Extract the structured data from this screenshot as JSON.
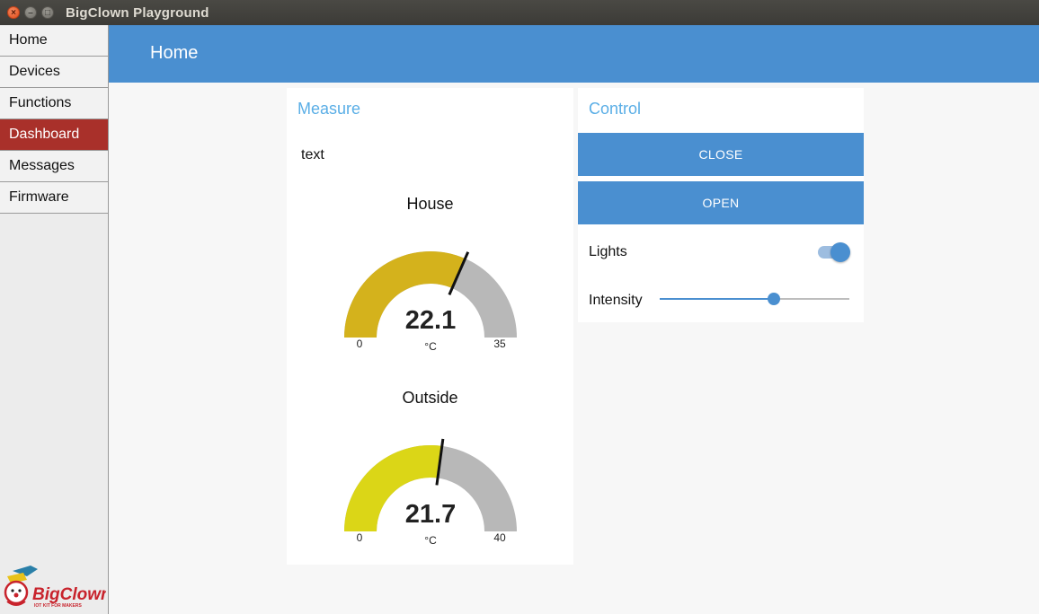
{
  "window": {
    "title": "BigClown Playground"
  },
  "sidebar": {
    "items": [
      {
        "label": "Home",
        "active": false
      },
      {
        "label": "Devices",
        "active": false
      },
      {
        "label": "Functions",
        "active": false
      },
      {
        "label": "Dashboard",
        "active": true
      },
      {
        "label": "Messages",
        "active": false
      },
      {
        "label": "Firmware",
        "active": false
      }
    ],
    "logo": {
      "name": "BigClown",
      "tagline": "IOT KIT FOR MAKERS"
    }
  },
  "header": {
    "title": "Home"
  },
  "measure": {
    "title": "Measure",
    "text": "text",
    "gauges": [
      {
        "label": "House",
        "value": 22.1,
        "display": "22.1",
        "min": 0,
        "max": 35,
        "min_label": "0",
        "max_label": "35",
        "unit": "°C",
        "color": "#d4b21c"
      },
      {
        "label": "Outside",
        "value": 21.7,
        "display": "21.7",
        "min": 0,
        "max": 40,
        "min_label": "0",
        "max_label": "40",
        "unit": "°C",
        "color": "#dbd617"
      }
    ]
  },
  "control": {
    "title": "Control",
    "close_label": "CLOSE",
    "open_label": "OPEN",
    "lights_label": "Lights",
    "lights_on": true,
    "intensity_label": "Intensity",
    "intensity_fraction": 0.6
  },
  "colors": {
    "accent": "#4a8fd0",
    "active_nav": "#a9302a",
    "card_title": "#5aaee6",
    "gauge_bg": "#b8b8b8"
  }
}
